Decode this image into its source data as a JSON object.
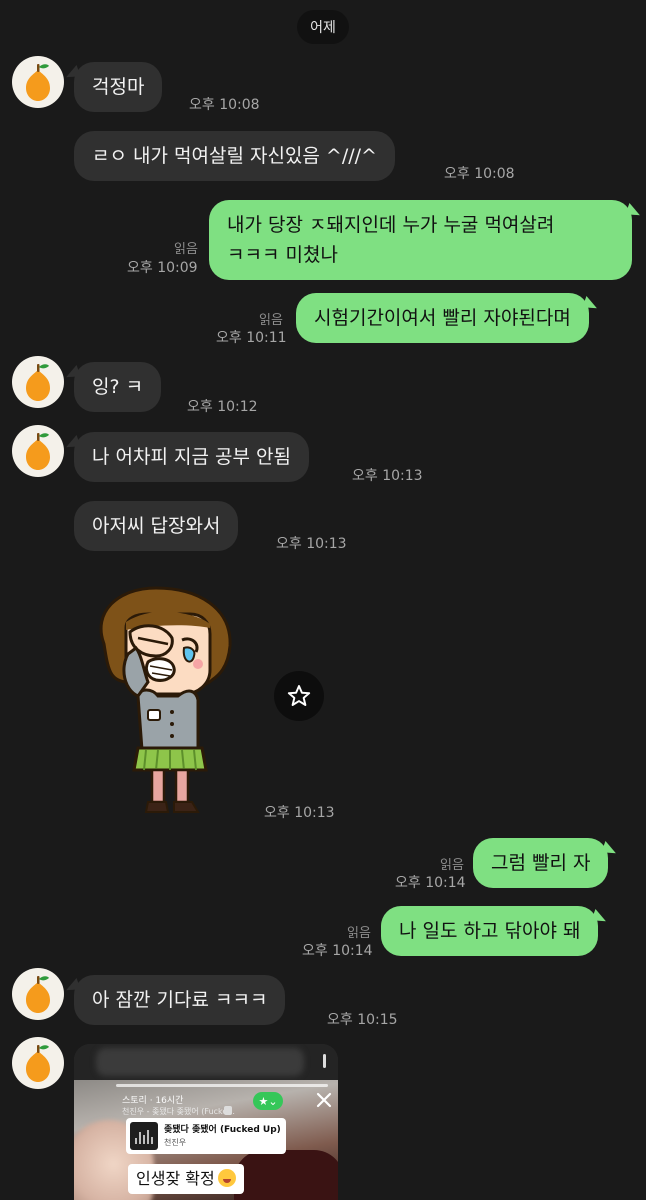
{
  "date_divider": "어제",
  "messages": [
    {
      "text": "걱정마",
      "time": "오후 10:08"
    },
    {
      "text": "ㄹㅇ 내가 먹여살릴 자신있음 ^///^",
      "time": "오후 10:08"
    },
    {
      "line1": "내가 당장 ㅈ돼지인데 누가 누굴 먹여살려",
      "line2": "ㅋㅋㅋ 미쳤나",
      "read": "읽음",
      "time": "오후 10:09"
    },
    {
      "text": "시험기간이여서 빨리 자야된다며",
      "read": "읽음",
      "time": "오후 10:11"
    },
    {
      "text": "잉? ㅋ",
      "time": "오후 10:12"
    },
    {
      "text": "나 어차피 지금 공부 안됨",
      "time": "오후 10:13"
    },
    {
      "text": "아저씨 답장와서",
      "time": "오후 10:13"
    },
    {
      "sticker": "crying-girl-sticker",
      "time": "오후 10:13"
    },
    {
      "text": "그럼 빨리 자",
      "read": "읽음",
      "time": "오후 10:14"
    },
    {
      "text": "나 일도 하고 닦아야 돼",
      "read": "읽음",
      "time": "오후 10:14"
    },
    {
      "text": "아 잠깐 기다료 ㅋㅋㅋ",
      "time": "오후 10:15"
    }
  ],
  "shared_story": {
    "header": "스토리 · 16시간",
    "music_line": "천진우 - 좆됐다 좆됐어 (Fucke...",
    "song_title": "좆됐다 좆됐어 (Fucked Up)",
    "artist": "천진우",
    "caption": "인생잦 확정"
  },
  "colors": {
    "background": "#1a1a1a",
    "incoming_bubble": "#303030",
    "outgoing_bubble": "#7fe082"
  }
}
